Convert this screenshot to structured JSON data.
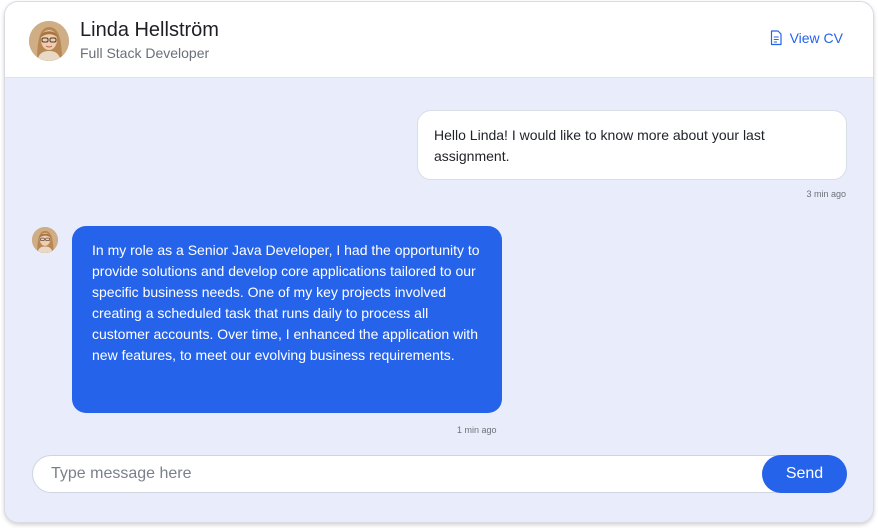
{
  "header": {
    "name": "Linda Hellström",
    "role": "Full Stack Developer",
    "view_cv_label": "View CV",
    "view_cv_icon": "document-icon"
  },
  "messages": [
    {
      "direction": "outgoing",
      "text": "Hello Linda! I would like to know more about your last assignment.",
      "time": "3 min ago"
    },
    {
      "direction": "incoming",
      "text": "In my role as a Senior Java Developer, I had the opportunity to provide solutions and develop core applications tailored to our specific business needs. One of my key projects involved creating a scheduled task that runs daily to process all customer accounts. Over time, I enhanced the application with new features, to meet our evolving business requirements.",
      "time": "1 min ago"
    }
  ],
  "composer": {
    "placeholder": "Type message here",
    "value": "",
    "send_label": "Send"
  },
  "colors": {
    "accent": "#2563eb",
    "chat_background": "#e9edfb",
    "outgoing_bubble": "#ffffff",
    "incoming_bubble": "#2563eb"
  }
}
